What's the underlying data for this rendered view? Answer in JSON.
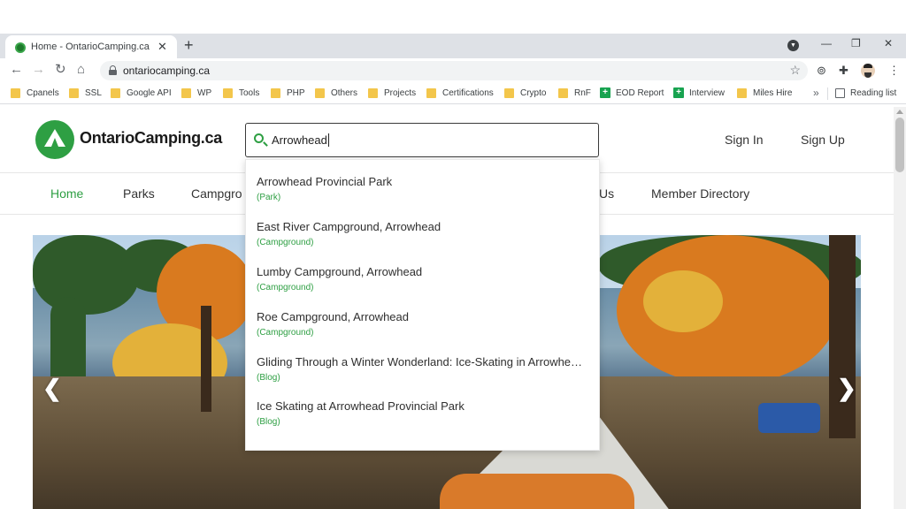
{
  "browser": {
    "tab_title": "Home - OntarioCamping.ca",
    "url": "ontariocamping.ca",
    "bookmarks": [
      "Cpanels",
      "SSL",
      "Google API",
      "WP",
      "Tools",
      "PHP",
      "Others",
      "Projects",
      "Certifications",
      "Crypto",
      "RnF",
      "EOD Report",
      "Interview",
      "Miles Hire"
    ],
    "reading_list": "Reading list",
    "icons": {
      "close": "✕",
      "new_tab": "+",
      "minimize": "—",
      "restore": "❐",
      "window_close": "✕",
      "back": "←",
      "forward": "→",
      "reload": "↻",
      "home": "⌂",
      "star": "☆",
      "extension": "⊚",
      "puzzle": "✚",
      "more": "⋮",
      "chevrons": "»",
      "tab_menu": "▼"
    }
  },
  "site": {
    "logo_text": "OntarioCamping.ca",
    "search_value": "Arrowhead",
    "sign_in": "Sign In",
    "sign_up": "Sign Up",
    "nav": [
      "Home",
      "Parks",
      "Campgro",
      "Us",
      "Member Directory"
    ],
    "carousel_prev": "❮",
    "carousel_next": "❯",
    "brand_color": "#2e9f43"
  },
  "suggestions": [
    {
      "title": "Arrowhead Provincial Park",
      "type": "(Park)"
    },
    {
      "title": "East River Campground, Arrowhead",
      "type": "(Campground)"
    },
    {
      "title": "Lumby Campground, Arrowhead",
      "type": "(Campground)"
    },
    {
      "title": "Roe Campground, Arrowhead",
      "type": "(Campground)"
    },
    {
      "title": "Gliding Through a Winter Wonderland: Ice-Skating in Arrowhe…",
      "type": "(Blog)"
    },
    {
      "title": "Ice Skating at Arrowhead Provincial Park",
      "type": "(Blog)"
    }
  ]
}
